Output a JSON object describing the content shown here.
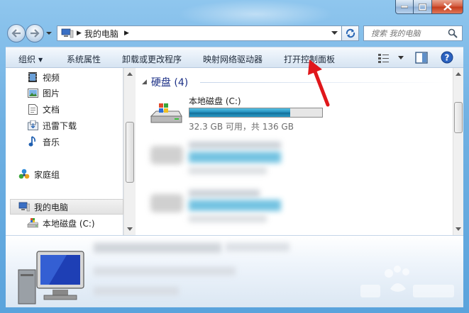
{
  "window": {
    "caption_buttons": [
      "minimize",
      "maximize",
      "close"
    ]
  },
  "address_bar": {
    "location": "我的电脑",
    "location_icon": "computer-icon"
  },
  "search": {
    "placeholder": "搜索 我的电脑"
  },
  "commands": {
    "organize": "组织",
    "system_properties": "系统属性",
    "uninstall": "卸载或更改程序",
    "map_drive": "映射网络驱动器",
    "control_panel": "打开控制面板"
  },
  "nav": {
    "favorites": [
      {
        "label": "视频",
        "icon": "video-library-icon"
      },
      {
        "label": "图片",
        "icon": "picture-library-icon"
      },
      {
        "label": "文档",
        "icon": "document-library-icon"
      },
      {
        "label": "迅雷下载",
        "icon": "download-folder-icon"
      },
      {
        "label": "音乐",
        "icon": "music-library-icon"
      }
    ],
    "homegroup": {
      "label": "家庭组",
      "icon": "homegroup-icon"
    },
    "computer": {
      "label": "我的电脑",
      "icon": "computer-icon"
    },
    "local_disk": {
      "label": "本地磁盘 (C:)",
      "icon": "drive-icon"
    }
  },
  "main": {
    "group_title": "硬盘 (4)",
    "drives": [
      {
        "name": "本地磁盘 (C:)",
        "info": "32.3 GB 可用，共 136 GB",
        "used_fraction": 0.76
      }
    ]
  },
  "colors": {
    "group_title": "#1e3287",
    "annotation_arrow": "#e0171b",
    "drive_bar": "#1e8ab8"
  }
}
